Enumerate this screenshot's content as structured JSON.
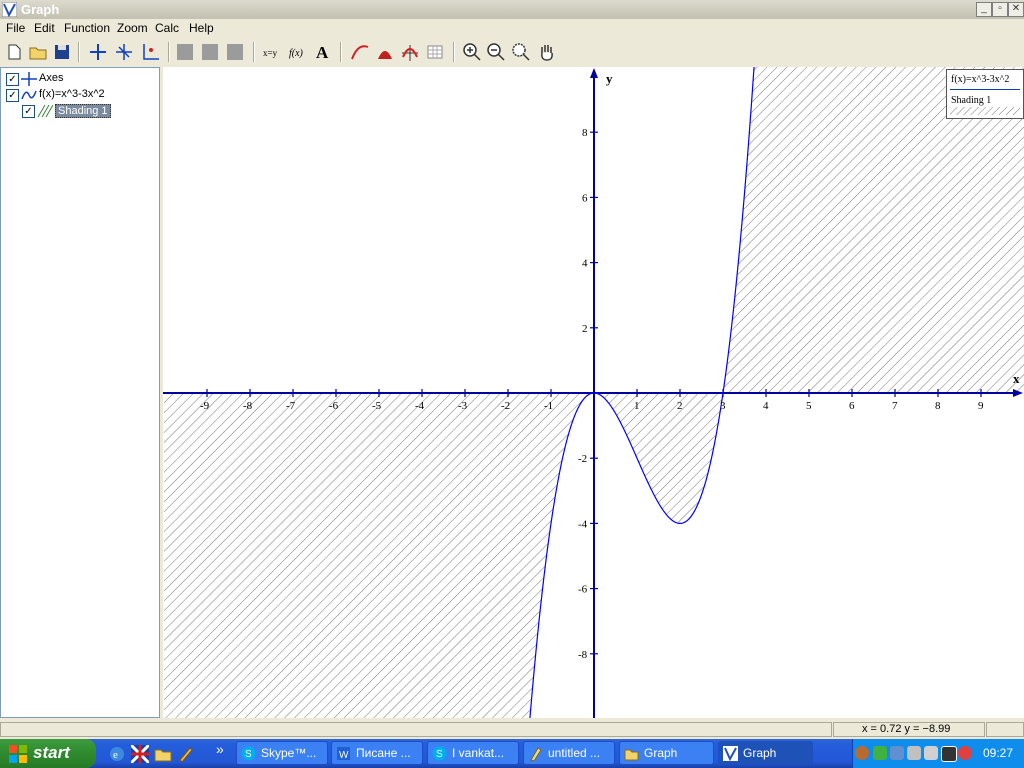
{
  "window": {
    "title": "Graph",
    "minimize": "_",
    "maximize": "▫",
    "close": "✕"
  },
  "menu": [
    "File",
    "Edit",
    "Function",
    "Zoom",
    "Calc",
    "Help"
  ],
  "tree": {
    "items": [
      {
        "label": "Axes",
        "checked": true,
        "icon": "axes-icon"
      },
      {
        "label": "f(x)=x^3-3x^2",
        "checked": true,
        "icon": "curve-icon"
      },
      {
        "label": "Shading 1",
        "checked": true,
        "icon": "shading-icon",
        "selected": true
      }
    ]
  },
  "graph": {
    "x_axis_label": "x",
    "y_axis_label": "y",
    "x_ticks": [
      "-9",
      "-8",
      "-7",
      "-6",
      "-5",
      "-4",
      "-3",
      "-2",
      "-1",
      "1",
      "2",
      "3",
      "4",
      "5",
      "6",
      "7",
      "8",
      "9"
    ],
    "y_ticks": [
      "8",
      "6",
      "4",
      "2",
      "-2",
      "-4",
      "-6",
      "-8"
    ],
    "legend": {
      "function": "f(x)=x^3-3x^2",
      "shading": "Shading 1"
    }
  },
  "chart_data": {
    "type": "line",
    "function": "x^3-3x^2",
    "xlim": [
      -10,
      10
    ],
    "ylim": [
      -10,
      10
    ],
    "shading": "between function and x-axis",
    "curve_color": "#0000ff",
    "axis_color": "#0000a0"
  },
  "status": {
    "coords": "x = 0.72    y = −8.99"
  },
  "taskbar": {
    "start": "start",
    "buttons": [
      {
        "label": "Skype™...",
        "active": false
      },
      {
        "label": "Писане ...",
        "active": false
      },
      {
        "label": "I vankat...",
        "active": false
      },
      {
        "label": "untitled ...",
        "active": false
      },
      {
        "label": "Graph",
        "active": false
      },
      {
        "label": "Graph",
        "active": true
      }
    ],
    "clock": "09:27",
    "chevron": "»"
  }
}
